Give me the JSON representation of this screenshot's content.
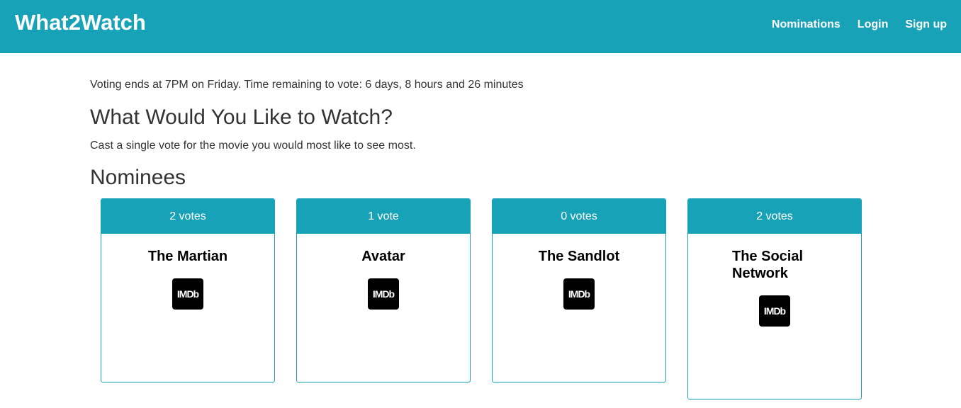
{
  "header": {
    "brand": "What2Watch",
    "nav": [
      "Nominations",
      "Login",
      "Sign up"
    ]
  },
  "voting": {
    "info": "Voting ends at 7PM on Friday. Time remaining to vote: 6 days, 8 hours and 26 minutes"
  },
  "page": {
    "title": "What Would You Like to Watch?",
    "subtitle": "Cast a single vote for the movie you would most like to see most.",
    "section_title": "Nominees"
  },
  "nominees": [
    {
      "votes": "2 votes",
      "title": "The Martian",
      "link_icon": "imdb-icon",
      "link_label": "IMDb"
    },
    {
      "votes": "1 vote",
      "title": "Avatar",
      "link_icon": "imdb-icon",
      "link_label": "IMDb"
    },
    {
      "votes": "0 votes",
      "title": "The Sandlot",
      "link_icon": "imdb-icon",
      "link_label": "IMDb"
    },
    {
      "votes": "2 votes",
      "title": "The Social Network",
      "link_icon": "imdb-icon",
      "link_label": "IMDb"
    }
  ],
  "colors": {
    "accent": "#17a2b8",
    "text": "#333333",
    "icon_bg": "#000000"
  }
}
